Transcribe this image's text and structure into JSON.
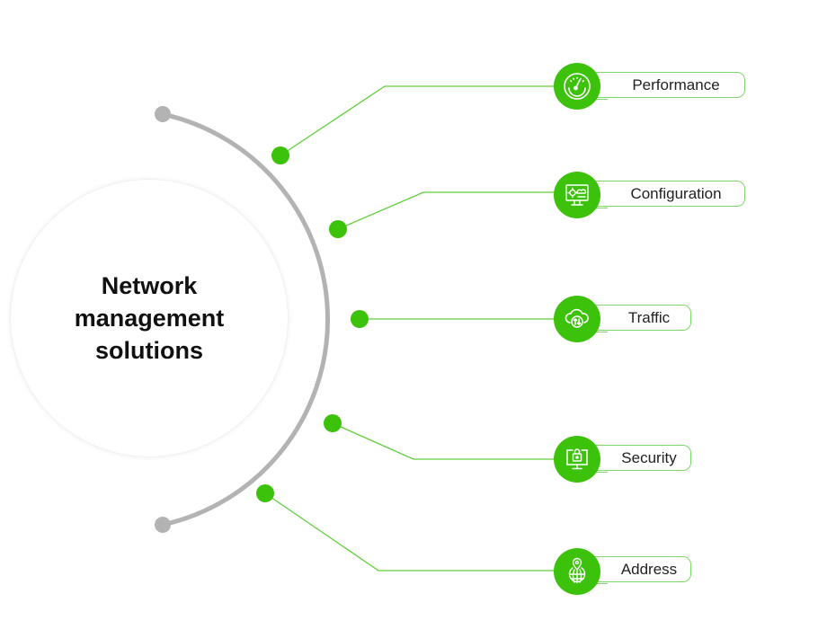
{
  "center": {
    "title_line1": "Network",
    "title_line2": "management",
    "title_line3": "solutions"
  },
  "colors": {
    "accent_green": "#3cc20a",
    "connector_green": "#5fcf3a",
    "pill_border": "#7fd86a",
    "arc_gray": "#b3b3b3"
  },
  "items": [
    {
      "label": "Performance",
      "icon": "speedometer-icon"
    },
    {
      "label": "Configuration",
      "icon": "monitor-gear-cloud-icon"
    },
    {
      "label": "Traffic",
      "icon": "cloud-transfer-icon"
    },
    {
      "label": "Security",
      "icon": "monitor-lock-icon"
    },
    {
      "label": "Address",
      "icon": "globe-pin-icon"
    }
  ]
}
